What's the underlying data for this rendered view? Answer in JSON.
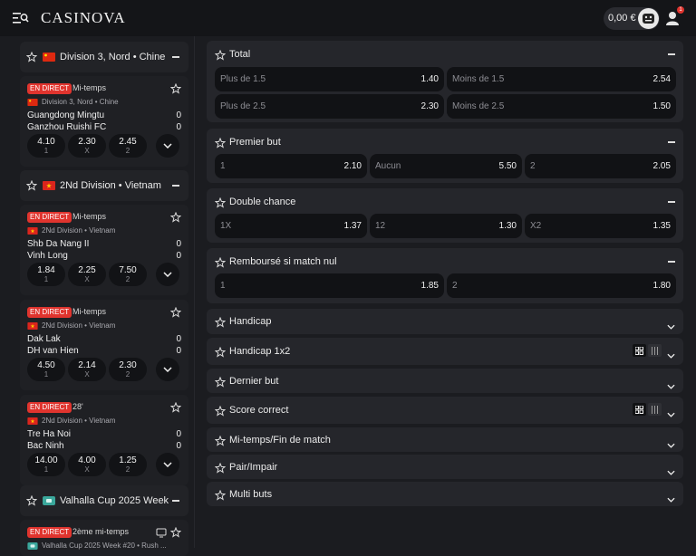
{
  "header": {
    "logo": "CASINOVA",
    "balance": "0,00 €",
    "notification_count": "1",
    "icons": [
      "menu-search-icon",
      "wallet-face-icon",
      "user-icon"
    ]
  },
  "sidebar": {
    "groups": [
      {
        "title": "Division 3, Nord • Chine",
        "flag": "china",
        "matches": [
          {
            "live": "EN DIRECT",
            "status": "Mi-temps",
            "league": "Division 3, Nord • Chine",
            "home": "Guangdong Mingtu",
            "away": "Ganzhou Ruishi FC",
            "home_score": "0",
            "away_score": "0",
            "odds": [
              {
                "v": "4.10",
                "l": "1"
              },
              {
                "v": "2.30",
                "l": "X"
              },
              {
                "v": "2.45",
                "l": "2"
              }
            ]
          }
        ]
      },
      {
        "title": "2Nd Division • Vietnam",
        "flag": "vietnam",
        "matches": [
          {
            "live": "EN DIRECT",
            "status": "Mi-temps",
            "league": "2Nd Division • Vietnam",
            "home": "Shb Da Nang II",
            "away": "Vinh Long",
            "home_score": "0",
            "away_score": "0",
            "odds": [
              {
                "v": "1.84",
                "l": "1"
              },
              {
                "v": "2.25",
                "l": "X"
              },
              {
                "v": "7.50",
                "l": "2"
              }
            ]
          },
          {
            "live": "EN DIRECT",
            "status": "Mi-temps",
            "league": "2Nd Division • Vietnam",
            "home": "Dak Lak",
            "away": "DH van Hien",
            "home_score": "0",
            "away_score": "0",
            "odds": [
              {
                "v": "4.50",
                "l": "1"
              },
              {
                "v": "2.14",
                "l": "X"
              },
              {
                "v": "2.30",
                "l": "2"
              }
            ]
          },
          {
            "live": "EN DIRECT",
            "status": "28'",
            "league": "2Nd Division • Vietnam",
            "home": "Tre Ha Noi",
            "away": "Bac Ninh",
            "home_score": "0",
            "away_score": "0",
            "odds": [
              {
                "v": "14.00",
                "l": "1"
              },
              {
                "v": "4.00",
                "l": "X"
              },
              {
                "v": "1.25",
                "l": "2"
              }
            ]
          }
        ]
      },
      {
        "title": "Valhalla Cup 2025 Week ...",
        "flag": "esports",
        "matches": [
          {
            "live": "EN DIRECT",
            "status": "2ème mi-temps",
            "league": "Valhalla Cup 2025 Week #20 • Rush ..."
          }
        ]
      }
    ]
  },
  "markets": [
    {
      "title": "Total",
      "expanded": true,
      "rows": [
        [
          {
            "label": "Plus de 1.5",
            "odd": "1.40"
          },
          {
            "label": "Moins de 1.5",
            "odd": "2.54"
          }
        ],
        [
          {
            "label": "Plus de 2.5",
            "odd": "2.30"
          },
          {
            "label": "Moins de 2.5",
            "odd": "1.50"
          }
        ]
      ]
    },
    {
      "title": "Premier but",
      "expanded": true,
      "rows": [
        [
          {
            "label": "1",
            "odd": "2.10"
          },
          {
            "label": "Aucun",
            "odd": "5.50"
          },
          {
            "label": "2",
            "odd": "2.05"
          }
        ]
      ]
    },
    {
      "title": "Double chance",
      "expanded": true,
      "rows": [
        [
          {
            "label": "1X",
            "odd": "1.37"
          },
          {
            "label": "12",
            "odd": "1.30"
          },
          {
            "label": "X2",
            "odd": "1.35"
          }
        ]
      ]
    },
    {
      "title": "Remboursé si match nul",
      "expanded": true,
      "rows": [
        [
          {
            "label": "1",
            "odd": "1.85"
          },
          {
            "label": "2",
            "odd": "1.80"
          }
        ]
      ]
    },
    {
      "title": "Handicap",
      "expanded": false
    },
    {
      "title": "Handicap 1x2",
      "expanded": false,
      "view_toggle": true
    },
    {
      "title": "Dernier but",
      "expanded": false
    },
    {
      "title": "Score correct",
      "expanded": false,
      "view_toggle": true
    },
    {
      "title": "Mi-temps/Fin de match",
      "expanded": false
    },
    {
      "title": "Pair/Impair",
      "expanded": false
    },
    {
      "title": "Multi buts",
      "expanded": false
    }
  ],
  "colors": {
    "live_badge": "#e0342e",
    "panel": "#25262b",
    "selection": "#111215",
    "background": "#1b1c20"
  }
}
